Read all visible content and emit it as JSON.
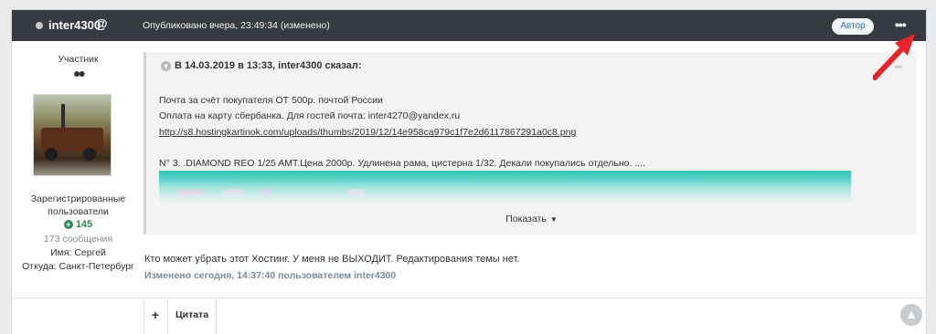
{
  "post_header": {
    "username": "inter4300",
    "at_symbol": "@",
    "published": "Опубликовано вчера, 23:49:34 (изменено)",
    "author_badge": "Автор",
    "more_label": "•••"
  },
  "sidebar": {
    "role": "Участник",
    "rank_dots": "●●",
    "group_line1": "Зарегистрированные",
    "group_line2": "пользователи",
    "reputation": "145",
    "posts_count": "173 сообщения",
    "name_field": "Имя: Сергей",
    "city_field": "Откуда: Санкт-Петербург"
  },
  "quote": {
    "header": "В 14.03.2019 в 13:33, inter4300 сказал:",
    "line1": "Почта  за счёт покупателя ОТ 500р.  почтой России",
    "line2": " Оплата на карту сбербанка.     Для гостей почта: inter4270@yandex.ru",
    "link": "http://s8.hostingkartinok.com/uploads/thumbs/2019/12/14e958ca979c1f7e2d6117867291a0c8.png",
    "line4": "N° 3. .DIAMOND REO 1/25 AMT.Цена 2000р. Удлинена рама, цистерна 1/32.  Декали покупались отдельно. ....",
    "show_more": "Показать"
  },
  "post_body": {
    "reply_text": "Кто может убрать этот Хостинг. У меня не ВЫХОДИТ. Редактирования темы нет.",
    "edited_note": "Изменено сегодня, 14:37:40 пользователем inter4300"
  },
  "footer": {
    "plus_label": "+",
    "quote_label": "Цитата"
  },
  "colors": {
    "header_bg": "#373a40",
    "reputation_green": "#2e8b57",
    "annotation_arrow": "#e8242a"
  }
}
